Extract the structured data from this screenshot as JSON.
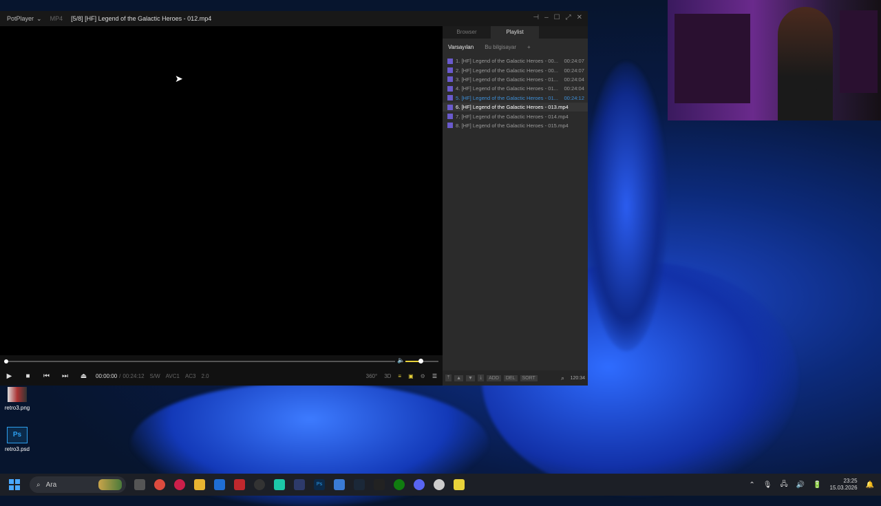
{
  "window": {
    "app_name": "PotPlayer",
    "format": "MP4",
    "title": "[5/8] [HF] Legend of the Galactic Heroes - 012.mp4"
  },
  "controls": {
    "time_current": "00:00:00",
    "time_separator": "/",
    "time_total": "00:24:12",
    "tags": [
      "S/W",
      "AVC1",
      "AC3",
      "2.0"
    ],
    "right_labels": [
      "360°",
      "3D"
    ],
    "seek_progress": 0,
    "volume_level": 0.45
  },
  "panel": {
    "tabs": [
      "Browser",
      "Playlist"
    ],
    "subtabs": [
      "Varsayılan",
      "Bu bilgisayar",
      "+"
    ],
    "items": [
      {
        "name": "1. [HF] Legend of the Galactic Heroes - 00...",
        "duration": "00:24:07"
      },
      {
        "name": "2. [HF] Legend of the Galactic Heroes - 00...",
        "duration": "00:24:07"
      },
      {
        "name": "3. [HF] Legend of the Galactic Heroes - 01...",
        "duration": "00:24:04"
      },
      {
        "name": "4. [HF] Legend of the Galactic Heroes - 01...",
        "duration": "00:24:04"
      },
      {
        "name": "5. [HF] Legend of the Galactic Heroes - 01...",
        "duration": "00:24:12"
      },
      {
        "name": "6. [HF] Legend of the Galactic Heroes - 013.mp4",
        "duration": ""
      },
      {
        "name": "7. [HF] Legend of the Galactic Heroes - 014.mp4",
        "duration": ""
      },
      {
        "name": "8. [HF] Legend of the Galactic Heroes - 015.mp4",
        "duration": ""
      }
    ],
    "bottom_buttons": [
      "ADD",
      "DEL",
      "SORT"
    ],
    "total_time": "120:34"
  },
  "desktop": {
    "icons": [
      {
        "label": "retro3.png"
      },
      {
        "label": "retro3.psd"
      }
    ]
  },
  "taskbar": {
    "search_placeholder": "Ara",
    "time": "23:25",
    "date": "15.03.2026"
  }
}
